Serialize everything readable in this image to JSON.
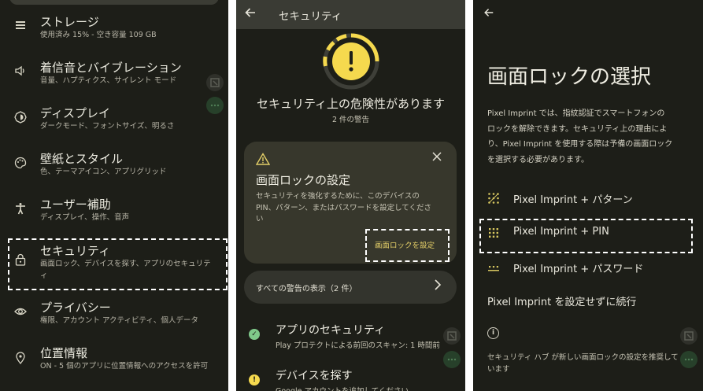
{
  "settings_list": {
    "items": [
      {
        "icon": "storage-icon",
        "title": "ストレージ",
        "subtitle": "使用済み 15% - 空き容量 109 GB"
      },
      {
        "icon": "sound-icon",
        "title": "着信音とバイブレーション",
        "subtitle": "音量、ハプティクス、サイレント モード"
      },
      {
        "icon": "display-icon",
        "title": "ディスプレイ",
        "subtitle": "ダークモード、フォントサイズ、明るさ"
      },
      {
        "icon": "palette-icon",
        "title": "壁紙とスタイル",
        "subtitle": "色、テーマアイコン、アプリグリッド"
      },
      {
        "icon": "accessibility-icon",
        "title": "ユーザー補助",
        "subtitle": "ディスプレイ、操作、音声"
      },
      {
        "icon": "lock-icon",
        "title": "セキュリティ",
        "subtitle_line1": "画面ロック、デバイスを探す、アプリのセキュリテ",
        "subtitle_line2": "ィ"
      },
      {
        "icon": "eye-icon",
        "title": "プライバシー",
        "subtitle": "権限、アカウント アクティビティ、個人データ"
      },
      {
        "icon": "location-icon",
        "title": "位置情報",
        "subtitle": "ON - 5 個のアプリに位置情報へのアクセスを許可"
      }
    ]
  },
  "security_page": {
    "header_title": "セキュリティ",
    "status_title": "セキュリティ上の危険性があります",
    "status_subtitle": "2 件の警告",
    "card": {
      "title": "画面ロックの設定",
      "body_line1": "セキュリティを強化するために、このデバイスの",
      "body_line2": "PIN、パターン、またはパスワードを設定してくださ",
      "body_line3": "い",
      "action_label": "画面ロックを設定"
    },
    "all_warnings_label": "すべての警告の表示（2 件）",
    "rows": [
      {
        "title": "アプリのセキュリティ",
        "subtitle": "Play プロテクトによる前回のスキャン: 1 時間前",
        "status": "ok"
      },
      {
        "title": "デバイスを探す",
        "subtitle": "Google アカウントを追加してください",
        "status": "warning"
      }
    ]
  },
  "screen_lock_page": {
    "title": "画面ロックの選択",
    "desc_line1": "Pixel Imprint では、指紋認証でスマートフォンの",
    "desc_line2": "ロックを解除できます。セキュリティ上の理由によ",
    "desc_line3": "り、Pixel Imprint を使用する際は予備の画面ロック",
    "desc_line4": "を選択する必要があります。",
    "options": [
      {
        "icon": "pattern-icon",
        "label": "Pixel Imprint + パターン"
      },
      {
        "icon": "pin-icon",
        "label": "Pixel Imprint + PIN"
      },
      {
        "icon": "password-icon",
        "label": "Pixel Imprint + パスワード"
      }
    ],
    "skip_label": "Pixel Imprint を設定せずに続行",
    "note_line1": "セキュリティ ハブ が新しい画面ロックの設定を推奨して",
    "note_line2": "います"
  },
  "colors": {
    "background": "#1d1e18",
    "accent_yellow": "#f5d94e",
    "ok_green": "#7fc98a",
    "action_yellow": "#e4cf68"
  }
}
